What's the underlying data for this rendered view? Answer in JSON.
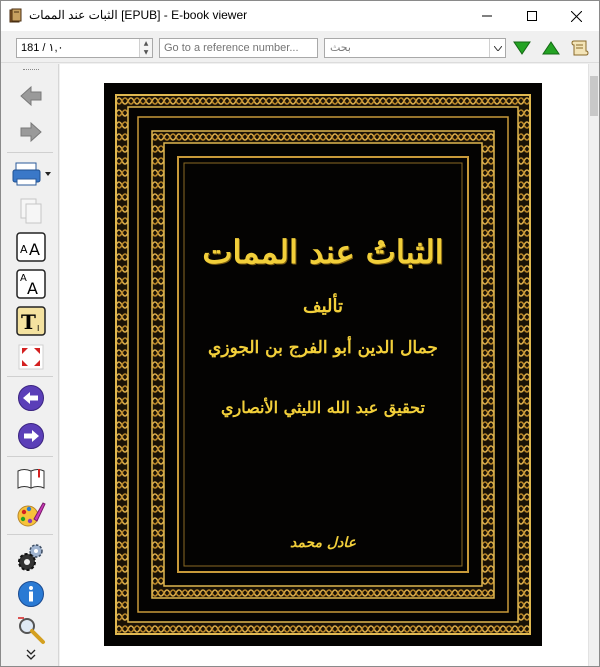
{
  "window": {
    "title": "الثبات عند الممات [EPUB] - E-book viewer"
  },
  "toolbar": {
    "page_value": "181 / ١,٠",
    "reference_placeholder": "Go to a reference number...",
    "search_placeholder": "بحث"
  },
  "sidebar": {
    "buttons": [
      "back-icon",
      "forward-icon",
      "print-icon",
      "copy-icon",
      "font-larger-icon",
      "font-smaller-icon",
      "text-style-icon",
      "fullscreen-icon",
      "previous-page-icon",
      "next-page-icon",
      "table-of-contents-icon",
      "themes-icon",
      "preferences-icon",
      "info-icon",
      "lookup-icon",
      "more-icon"
    ]
  },
  "book_cover": {
    "title": "الثباتُ عند الممات",
    "author_label": "تأليف",
    "author": "جمال الدين أبو الفرج بن الجوزي",
    "editor": "تحقيق عبد الله الليثي الأنصاري",
    "calligrapher_signature": "عادل محمد"
  },
  "colors": {
    "cover_background": "#040302",
    "cover_gold": "#f2cf3a",
    "frame_gold": "#c89a3a",
    "nav_purple": "#5b3fb8",
    "arrow_green": "#24a324"
  }
}
